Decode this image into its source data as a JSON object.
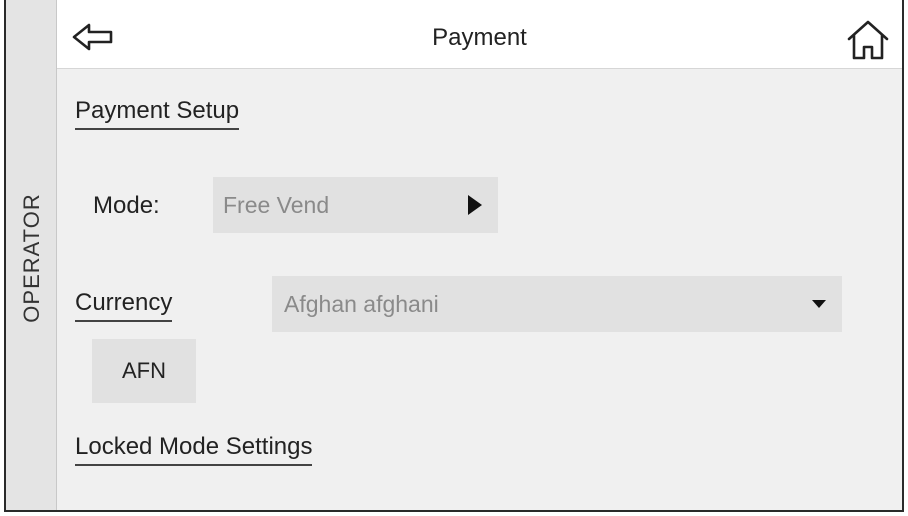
{
  "sidebar": {
    "label": "OPERATOR"
  },
  "header": {
    "title": "Payment",
    "back_icon": "back-arrow-icon",
    "home_icon": "home-icon"
  },
  "payment_setup": {
    "section_title": "Payment Setup",
    "mode_label": "Mode:",
    "mode_value": "Free Vend",
    "currency_label": "Currency",
    "currency_value": "Afghan afghani",
    "currency_code": "AFN"
  },
  "locked_mode": {
    "section_title": "Locked Mode Settings"
  }
}
